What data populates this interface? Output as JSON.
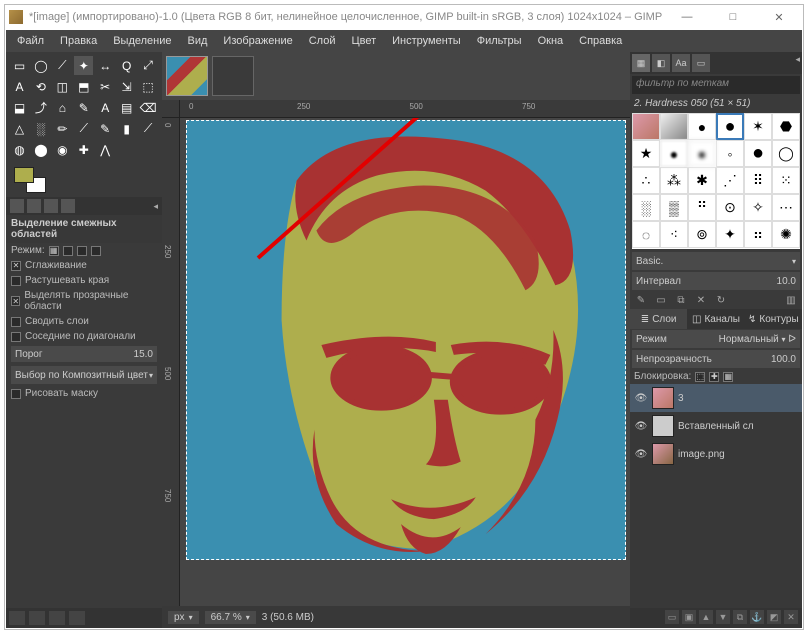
{
  "window": {
    "title": "*[image] (импортировано)-1.0 (Цвета RGB 8 бит, нелинейное целочисленное, GIMP built-in sRGB, 3 слоя) 1024x1024 – GIMP",
    "minimize": "—",
    "maximize": "□",
    "close": "✕"
  },
  "menu": {
    "file": "Файл",
    "edit": "Правка",
    "select": "Выделение",
    "view": "Вид",
    "image": "Изображение",
    "layer": "Слой",
    "color": "Цвет",
    "tools": "Инструменты",
    "filters": "Фильтры",
    "windows": "Окна",
    "help": "Справка"
  },
  "toolbox": {
    "tools": [
      "▭",
      "◯",
      "⟋",
      "✦",
      "↔",
      "Q",
      "⤢",
      "A",
      "⟲",
      "◫",
      "⬒",
      "✂",
      "⇲",
      "⬚",
      "⬓",
      "⤴",
      "⌂",
      "✎",
      "A",
      "▤",
      "⌫",
      "△",
      "░",
      "✏",
      "⟋",
      "✎",
      "▮",
      "⟋",
      "◍",
      "⬤",
      "◉",
      "✚",
      "⋀"
    ],
    "fg_color": "#aeae4d",
    "bg_color": "#ffffff"
  },
  "options": {
    "title": "Выделение смежных областей",
    "mode_label": "Режим:",
    "antialias": "Сглаживание",
    "feather": "Растушевать края",
    "select_transparent": "Выделять прозрачные области",
    "sample_merged": "Сводить слои",
    "diagonal": "Соседние по диагонали",
    "threshold_label": "Порог",
    "threshold_value": "15.0",
    "select_by_label": "Выбор по",
    "select_by_value": "Композитный цвет",
    "draw_mask": "Рисовать маску"
  },
  "ruler": {
    "h": [
      "0",
      "250",
      "500",
      "750"
    ],
    "v": [
      "0",
      "250",
      "500",
      "750"
    ]
  },
  "status": {
    "unit": "px",
    "zoom": "66.7 %",
    "info": "3 (50.6 MB)"
  },
  "right": {
    "filter_placeholder": "фильтр по меткам",
    "brush_label": "2. Hardness 050 (51 × 51)",
    "preset_label": "Basic.",
    "interval_label": "Интервал",
    "interval_value": "10.0",
    "layers_tab": "Слои",
    "channels_tab": "Каналы",
    "paths_tab": "Контуры",
    "mode_label": "Режим",
    "mode_value": "Нормальный",
    "opacity_label": "Непрозрачность",
    "opacity_value": "100.0",
    "lock_label": "Блокировка:",
    "layers": [
      {
        "name": "3",
        "visible": true
      },
      {
        "name": "Вставленный сл",
        "visible": true
      },
      {
        "name": "image.png",
        "visible": true
      }
    ]
  }
}
